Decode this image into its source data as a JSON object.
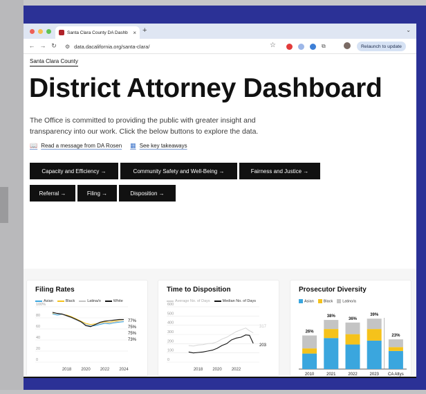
{
  "browser": {
    "tab_title": "Santa Clara County DA Dashb",
    "url": "data.dacalifornia.org/santa-clara/",
    "relaunch_label": "Relaunch to update",
    "icons": [
      "back-arrow",
      "forward-arrow",
      "reload",
      "site-settings",
      "star",
      "extensions-puzzle"
    ]
  },
  "header": {
    "county_link": "Santa Clara County",
    "title": "District Attorney Dashboard",
    "intro": "The Office is committed to providing the public with greater insight and transparency into our work. Click the below buttons to explore the data."
  },
  "links": {
    "message": "Read a message from DA Rosen",
    "takeaways": "See key takeaways"
  },
  "buttons": {
    "row1": [
      "Capacity and Efficiency →",
      "Community Safety and Well-Being →",
      "Fairness and Justice →"
    ],
    "row2": [
      "Referral →",
      "Filing →",
      "Disposition →"
    ]
  },
  "colors": {
    "accent_blue": "#3aa6de",
    "accent_yellow": "#f5c21b",
    "gray": "#c4c4c4",
    "button_bg": "#111111"
  },
  "chart_data": [
    {
      "type": "line",
      "title": "Filing Rates",
      "legend": [
        "Asian",
        "Black",
        "Latina/o",
        "White"
      ],
      "x": [
        2016.5,
        2017,
        2017.5,
        2018,
        2018.5,
        2019,
        2019.5,
        2020,
        2020.5,
        2021,
        2021.5,
        2022,
        2022.5,
        2023,
        2023.5,
        2024
      ],
      "xticks": [
        "2018",
        "2020",
        "2022",
        "2024"
      ],
      "yticks": [
        "0",
        "20",
        "40",
        "60",
        "80",
        "100%"
      ],
      "ylim": [
        0,
        100
      ],
      "series": [
        {
          "name": "Asian",
          "values": [
            87,
            85,
            86,
            84,
            80,
            76,
            73,
            68,
            65,
            66,
            68,
            70,
            69,
            71,
            72,
            73
          ]
        },
        {
          "name": "Black",
          "values": [
            88,
            88,
            86,
            85,
            82,
            78,
            74,
            70,
            68,
            69,
            71,
            73,
            72,
            74,
            75,
            75
          ]
        },
        {
          "name": "Latina/o",
          "values": [
            89,
            87,
            86,
            83,
            80,
            76,
            72,
            68,
            66,
            67,
            70,
            71,
            71,
            72,
            74,
            75
          ]
        },
        {
          "name": "White",
          "values": [
            90,
            88,
            87,
            84,
            81,
            77,
            73,
            66,
            64,
            68,
            72,
            74,
            75,
            76,
            77,
            77
          ]
        }
      ],
      "end_labels": [
        "77%",
        "75%",
        "75%",
        "73%"
      ]
    },
    {
      "type": "line",
      "title": "Time to Disposition",
      "legend": [
        "Average No. of Days",
        "Median No. of Days"
      ],
      "x": [
        2017,
        2017.5,
        2018,
        2018.5,
        2019,
        2019.5,
        2020,
        2020.5,
        2021,
        2021.5,
        2022,
        2022.5,
        2023,
        2023.4,
        2023.8
      ],
      "xticks": [
        "2018",
        "2020",
        "2022"
      ],
      "yticks": [
        "0",
        "100",
        "200",
        "300",
        "400",
        "500",
        "600"
      ],
      "ylim": [
        0,
        600
      ],
      "series": [
        {
          "name": "Average No. of Days",
          "values": [
            180,
            175,
            185,
            190,
            200,
            205,
            220,
            250,
            270,
            300,
            330,
            350,
            370,
            340,
            317
          ]
        },
        {
          "name": "Median No. of Days",
          "values": [
            110,
            100,
            105,
            110,
            120,
            130,
            150,
            180,
            200,
            240,
            260,
            270,
            295,
            290,
            203
          ]
        }
      ],
      "end_labels": [
        "317",
        "203"
      ]
    },
    {
      "type": "bar",
      "title": "Prosecutor Diversity",
      "legend": [
        "Asian",
        "Black",
        "Latino/a"
      ],
      "categories": [
        "2010",
        "2021",
        "2022",
        "2023",
        "CA Attys"
      ],
      "series": [
        {
          "name": "Asian",
          "values": [
            12,
            24,
            19,
            22,
            14
          ]
        },
        {
          "name": "Black",
          "values": [
            4,
            7,
            8,
            9,
            3
          ]
        },
        {
          "name": "Latino/a",
          "values": [
            10,
            7,
            9,
            8,
            6
          ]
        }
      ],
      "totals": [
        "26%",
        "38%",
        "36%",
        "39%",
        "23%"
      ],
      "ylim": [
        0,
        45
      ]
    }
  ]
}
